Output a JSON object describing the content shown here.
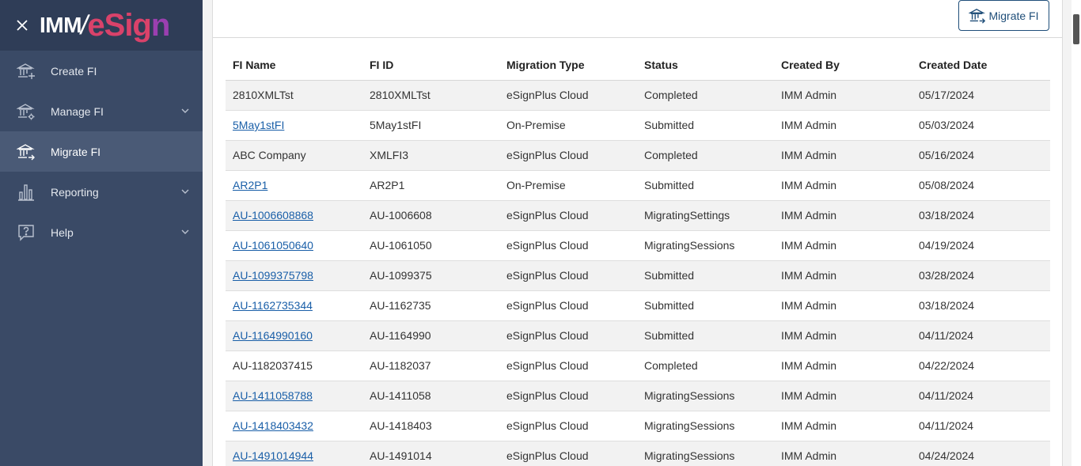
{
  "brand": {
    "imm": "IMM",
    "esign_e": "e",
    "esign_sig": "Sig",
    "esign_n": "n"
  },
  "sidebar": {
    "items": [
      {
        "label": "Create FI",
        "icon": "bank-add-icon",
        "has_chevron": false
      },
      {
        "label": "Manage FI",
        "icon": "bank-gear-icon",
        "has_chevron": true
      },
      {
        "label": "Migrate FI",
        "icon": "bank-arrow-icon",
        "has_chevron": false,
        "active": true
      },
      {
        "label": "Reporting",
        "icon": "bar-chart-icon",
        "has_chevron": true
      },
      {
        "label": "Help",
        "icon": "help-bubble-icon",
        "has_chevron": true
      }
    ]
  },
  "toolbar": {
    "migrate_label": "Migrate FI"
  },
  "table": {
    "headers": [
      "FI Name",
      "FI ID",
      "Migration Type",
      "Status",
      "Created By",
      "Created Date"
    ],
    "rows": [
      {
        "name": "2810XMLTst",
        "link": false,
        "id": "2810XMLTst",
        "type": "eSignPlus Cloud",
        "status": "Completed",
        "by": "IMM Admin",
        "date": "05/17/2024"
      },
      {
        "name": "5May1stFI",
        "link": true,
        "id": "5May1stFI",
        "type": "On-Premise",
        "status": "Submitted",
        "by": "IMM Admin",
        "date": "05/03/2024"
      },
      {
        "name": "ABC Company",
        "link": false,
        "id": "XMLFI3",
        "type": "eSignPlus Cloud",
        "status": "Completed",
        "by": "IMM Admin",
        "date": "05/16/2024"
      },
      {
        "name": "AR2P1",
        "link": true,
        "id": "AR2P1",
        "type": "On-Premise",
        "status": "Submitted",
        "by": "IMM Admin",
        "date": "05/08/2024"
      },
      {
        "name": "AU-1006608868",
        "link": true,
        "id": "AU-1006608",
        "type": "eSignPlus Cloud",
        "status": "MigratingSettings",
        "by": "IMM Admin",
        "date": "03/18/2024"
      },
      {
        "name": "AU-1061050640",
        "link": true,
        "id": "AU-1061050",
        "type": "eSignPlus Cloud",
        "status": "MigratingSessions",
        "by": "IMM Admin",
        "date": "04/19/2024"
      },
      {
        "name": "AU-1099375798",
        "link": true,
        "id": "AU-1099375",
        "type": "eSignPlus Cloud",
        "status": "Submitted",
        "by": "IMM Admin",
        "date": "03/28/2024"
      },
      {
        "name": "AU-1162735344",
        "link": true,
        "id": "AU-1162735",
        "type": "eSignPlus Cloud",
        "status": "Submitted",
        "by": "IMM Admin",
        "date": "03/18/2024"
      },
      {
        "name": "AU-1164990160",
        "link": true,
        "id": "AU-1164990",
        "type": "eSignPlus Cloud",
        "status": "Submitted",
        "by": "IMM Admin",
        "date": "04/11/2024"
      },
      {
        "name": "AU-1182037415",
        "link": false,
        "id": "AU-1182037",
        "type": "eSignPlus Cloud",
        "status": "Completed",
        "by": "IMM Admin",
        "date": "04/22/2024"
      },
      {
        "name": "AU-1411058788",
        "link": true,
        "id": "AU-1411058",
        "type": "eSignPlus Cloud",
        "status": "MigratingSessions",
        "by": "IMM Admin",
        "date": "04/11/2024"
      },
      {
        "name": "AU-1418403432",
        "link": true,
        "id": "AU-1418403",
        "type": "eSignPlus Cloud",
        "status": "MigratingSessions",
        "by": "IMM Admin",
        "date": "04/11/2024"
      },
      {
        "name": "AU-1491014944",
        "link": true,
        "id": "AU-1491014",
        "type": "eSignPlus Cloud",
        "status": "MigratingSessions",
        "by": "IMM Admin",
        "date": "04/24/2024"
      }
    ]
  }
}
